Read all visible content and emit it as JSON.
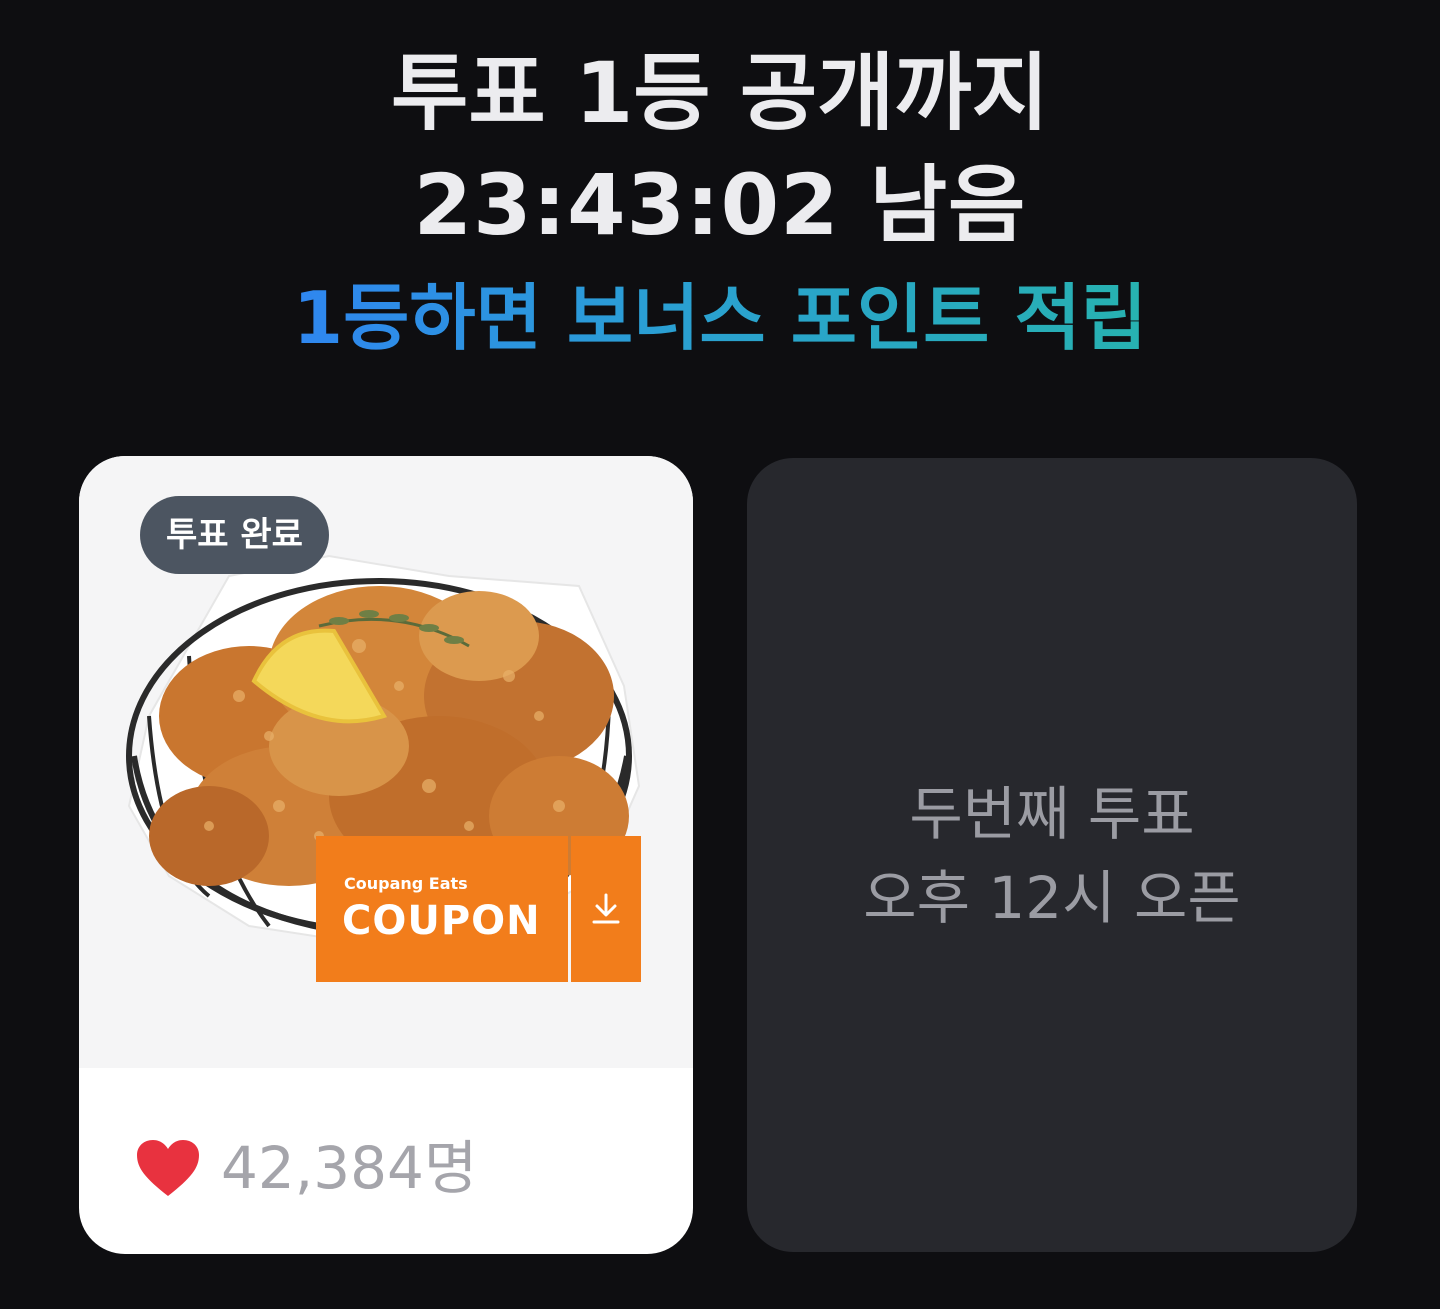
{
  "header": {
    "title_line1": "투표 1등 공개까지",
    "countdown_line": "23:43:02 남음",
    "bonus_text": "1등하면 보너스 포인트 적립"
  },
  "cards": {
    "voted": {
      "badge": "투표 완료",
      "coupon_brand": "Coupang Eats",
      "coupon_label": "COUPON",
      "likes_count": "42,384명"
    },
    "upcoming": {
      "line1": "두번째 투표",
      "line2": "오후 12시 오픈"
    }
  },
  "icons": {
    "heart": "heart-icon",
    "download": "download-icon"
  },
  "colors": {
    "background": "#0e0e11",
    "accent_start": "#2f86f0",
    "accent_end": "#27b2b0",
    "coupon_orange": "#f27d1b",
    "heart_red": "#e8323f",
    "badge_gray": "#4c5561",
    "upcoming_card": "#27282d"
  }
}
